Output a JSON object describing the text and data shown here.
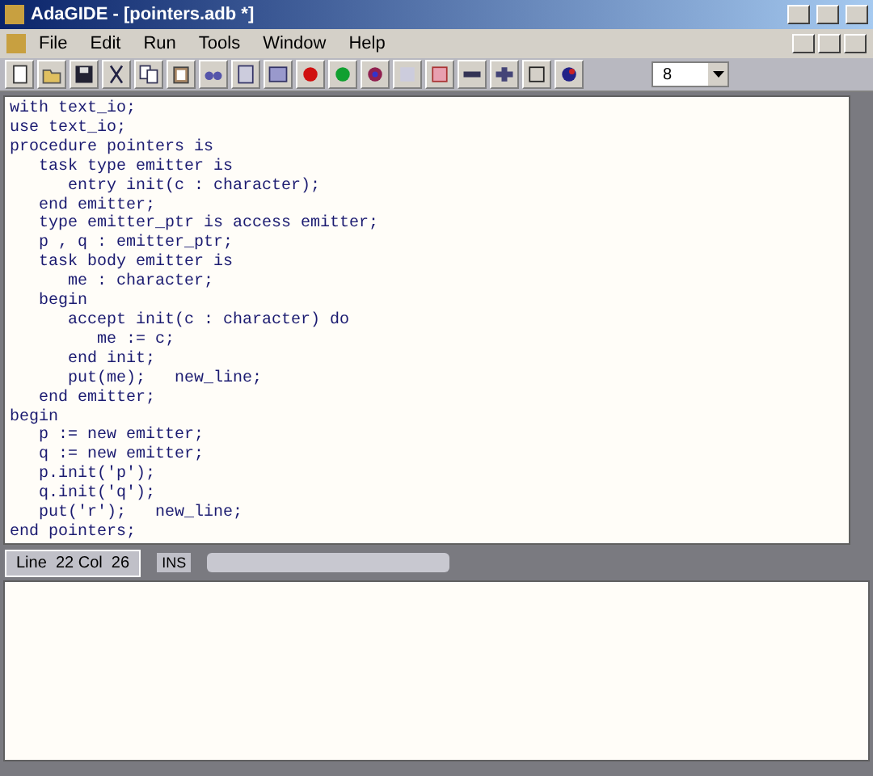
{
  "window": {
    "title": "AdaGIDE - [pointers.adb *]"
  },
  "menu": [
    "File",
    "Edit",
    "Run",
    "Tools",
    "Window",
    "Help"
  ],
  "toolbar": {
    "dropdown_value": "8"
  },
  "editor": {
    "lines": [
      "with text_io;",
      "use text_io;",
      "procedure pointers is",
      "   task type emitter is",
      "      entry init(c : character);",
      "   end emitter;",
      "   type emitter_ptr is access emitter;",
      "   p , q : emitter_ptr;",
      "   task body emitter is",
      "      me : character;",
      "   begin",
      "      accept init(c : character) do",
      "         me := c;",
      "      end init;",
      "      put(me);   new_line;",
      "   end emitter;",
      "begin",
      "   p := new emitter;",
      "   q := new emitter;",
      "   p.init('p');",
      "   q.init('q');",
      "   put('r');   new_line;",
      "end pointers;"
    ]
  },
  "status_bar": {
    "position": "Line  22 Col  26",
    "mode": "INS"
  }
}
